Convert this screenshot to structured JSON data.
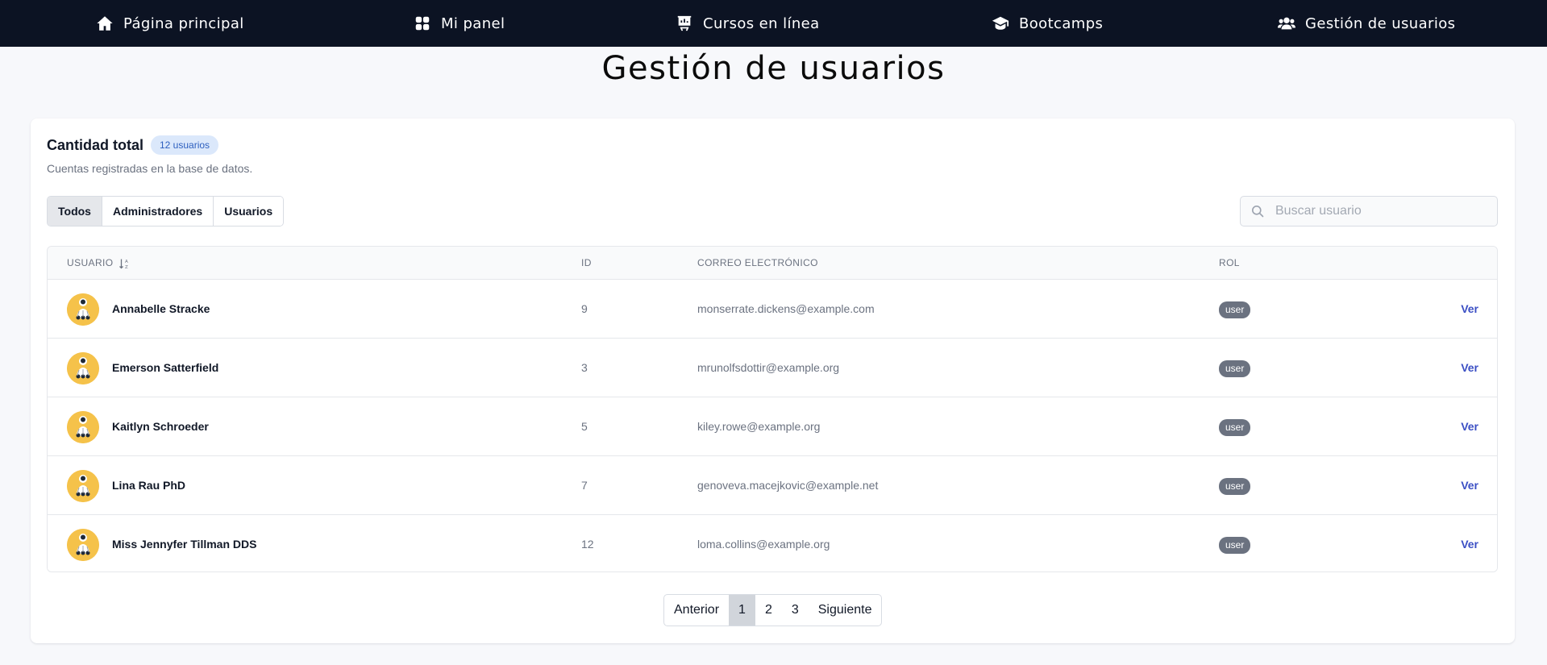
{
  "nav": {
    "items": [
      {
        "label": "Página principal",
        "icon": "home-icon"
      },
      {
        "label": "Mi panel",
        "icon": "grid-icon"
      },
      {
        "label": "Cursos en línea",
        "icon": "presentation-icon"
      },
      {
        "label": "Bootcamps",
        "icon": "graduation-cap-icon"
      },
      {
        "label": "Gestión de usuarios",
        "icon": "users-icon"
      }
    ]
  },
  "page": {
    "title": "Gestión de usuarios"
  },
  "card": {
    "title": "Cantidad total",
    "count_badge": "12 usuarios",
    "subtitle": "Cuentas registradas en la base de datos."
  },
  "tabs": [
    {
      "label": "Todos",
      "active": true
    },
    {
      "label": "Administradores",
      "active": false
    },
    {
      "label": "Usuarios",
      "active": false
    }
  ],
  "search": {
    "placeholder": "Buscar usuario",
    "value": ""
  },
  "table": {
    "headers": {
      "user": "Usuario",
      "id": "ID",
      "email": "Correo electrónico",
      "role": "Rol"
    },
    "rows": [
      {
        "name": "Annabelle Stracke",
        "id": "9",
        "email": "monserrate.dickens@example.com",
        "role": "user",
        "action": "Ver"
      },
      {
        "name": "Emerson Satterfield",
        "id": "3",
        "email": "mrunolfsdottir@example.org",
        "role": "user",
        "action": "Ver"
      },
      {
        "name": "Kaitlyn Schroeder",
        "id": "5",
        "email": "kiley.rowe@example.org",
        "role": "user",
        "action": "Ver"
      },
      {
        "name": "Lina Rau PhD",
        "id": "7",
        "email": "genoveva.macejkovic@example.net",
        "role": "user",
        "action": "Ver"
      },
      {
        "name": "Miss Jennyfer Tillman DDS",
        "id": "12",
        "email": "loma.collins@example.org",
        "role": "user",
        "action": "Ver"
      }
    ]
  },
  "pagination": {
    "prev": "Anterior",
    "pages": [
      "1",
      "2",
      "3"
    ],
    "current": "1",
    "next": "Siguiente"
  },
  "colors": {
    "nav_bg": "#0c1323",
    "link": "#3b4fc4",
    "badge_bg": "#dbe8fb",
    "role_badge": "#6b7280",
    "avatar": "#f5c24a"
  }
}
